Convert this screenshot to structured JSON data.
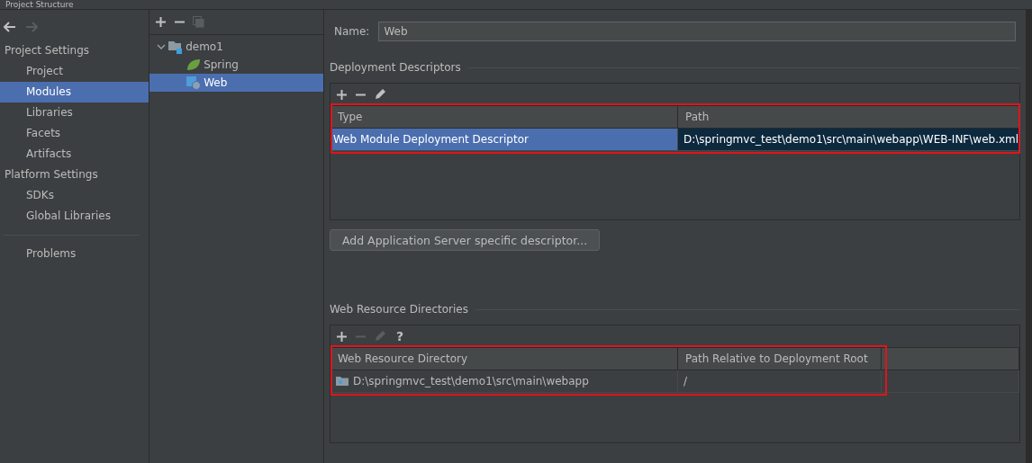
{
  "window": {
    "title": "Project Structure"
  },
  "nav": {
    "back_disabled": false,
    "forward_disabled": true
  },
  "sidebar": {
    "sections": [
      {
        "heading": "Project Settings",
        "items": [
          {
            "label": "Project",
            "selected": false
          },
          {
            "label": "Modules",
            "selected": true
          },
          {
            "label": "Libraries",
            "selected": false
          },
          {
            "label": "Facets",
            "selected": false
          },
          {
            "label": "Artifacts",
            "selected": false
          }
        ]
      },
      {
        "heading": "Platform Settings",
        "items": [
          {
            "label": "SDKs",
            "selected": false
          },
          {
            "label": "Global Libraries",
            "selected": false
          }
        ]
      }
    ],
    "problems": {
      "label": "Problems",
      "selected": false
    }
  },
  "tree": {
    "toolbar": [
      {
        "kind": "add",
        "disabled": false
      },
      {
        "kind": "remove",
        "disabled": false
      },
      {
        "kind": "copy",
        "disabled": true
      }
    ],
    "nodes": [
      {
        "label": "demo1",
        "kind": "module",
        "expanded": true,
        "selected": false,
        "children": [
          {
            "label": "Spring",
            "kind": "spring",
            "selected": false
          },
          {
            "label": "Web",
            "kind": "web",
            "selected": true
          }
        ]
      }
    ]
  },
  "name_field": {
    "label": "Name:",
    "value": "Web"
  },
  "deployment_descriptors": {
    "title": "Deployment Descriptors",
    "highlighted": true,
    "toolbar": [
      {
        "kind": "add",
        "disabled": false
      },
      {
        "kind": "remove",
        "disabled": false
      },
      {
        "kind": "edit",
        "disabled": false
      }
    ],
    "columns": [
      "Type",
      "Path"
    ],
    "rows": [
      {
        "cells": [
          "Web Module Deployment Descriptor",
          "D:\\springmvc_test\\demo1\\src\\main\\webapp\\WEB-INF\\web.xml"
        ],
        "selected": true
      }
    ]
  },
  "add_server_descriptor_button": "Add Application Server specific descriptor...",
  "web_resource_directories": {
    "title": "Web Resource Directories",
    "highlighted": true,
    "toolbar": [
      {
        "kind": "add",
        "disabled": false
      },
      {
        "kind": "remove",
        "disabled": true
      },
      {
        "kind": "edit",
        "disabled": true
      },
      {
        "kind": "help",
        "disabled": false,
        "glyph": "?"
      }
    ],
    "columns": [
      "Web Resource Directory",
      "Path Relative to Deployment Root"
    ],
    "rows": [
      {
        "cells": [
          "D:\\springmvc_test\\demo1\\src\\main\\webapp",
          "/"
        ],
        "selected": false
      }
    ]
  }
}
